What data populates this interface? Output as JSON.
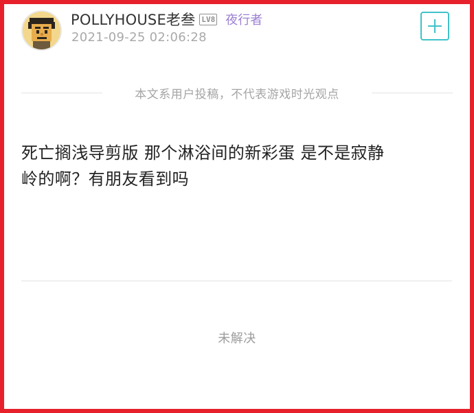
{
  "post_header": {
    "avatar_icon": "pixel-avatar-icon",
    "username": "POLLYHOUSE老叁",
    "level_badge": "LV8",
    "user_title": "夜行者",
    "timestamp": "2021-09-25 02:06:28",
    "follow_icon": "plus-icon"
  },
  "disclaimer": "本文系用户投稿，不代表游戏时光观点",
  "post": {
    "lines": [
      "死亡搁浅导剪版 那个淋浴间的新彩蛋 是不是寂静",
      "岭的啊？有朋友看到吗"
    ],
    "status": "未解决"
  },
  "colors": {
    "frame_border": "#e6212b",
    "accent_teal": "#3ec2c9",
    "user_title_purple": "#9b7fd3",
    "meta_gray": "#a9a9a9"
  }
}
